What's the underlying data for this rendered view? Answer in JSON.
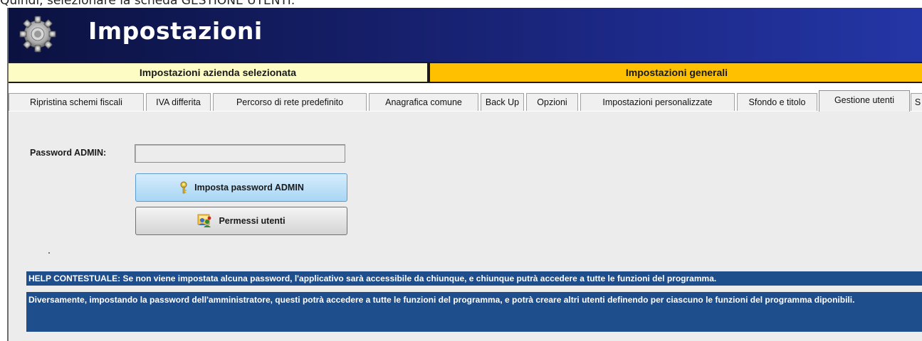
{
  "caption": "Quindi, selezionare la scheda GESTIONE UTENTI.",
  "window": {
    "title": "Impostazioni"
  },
  "subtabs": {
    "left": "Impostazioni azienda selezionata",
    "right": "Impostazioni generali"
  },
  "tabs": [
    "Ripristina schemi fiscali",
    "IVA differita",
    "Percorso di rete predefinito",
    "Anagrafica comune",
    "Back Up",
    "Opzioni",
    "Impostazioni personalizzate",
    "Sfondo e titolo",
    "Gestione utenti",
    "S"
  ],
  "active_tab": "Gestione utenti",
  "form": {
    "password_label": "Password ADMIN:",
    "password_value": "",
    "set_admin_button": "Imposta password ADMIN",
    "user_permissions_button": "Permessi utenti"
  },
  "help": {
    "line1": "HELP CONTESTUALE: Se non viene impostata alcuna password, l'applicativo sarà accessibile da chiunque, e chiunque putrà accedere a tutte le funzioni del programma.",
    "line2": "Diversamente, impostando la password dell'amministratore, questi  potrà accedere a tutte le funzioni del programma, e potrà creare altri utenti definendo per ciascuno le funzioni del programma diponibili."
  },
  "colors": {
    "titlebar": "#141d63",
    "subtab_left": "#fcfcc4",
    "subtab_right": "#ffc000",
    "help_bg": "#1f4e8c"
  },
  "icons": [
    "gear-icon",
    "key-icon",
    "users-permissions-icon"
  ]
}
